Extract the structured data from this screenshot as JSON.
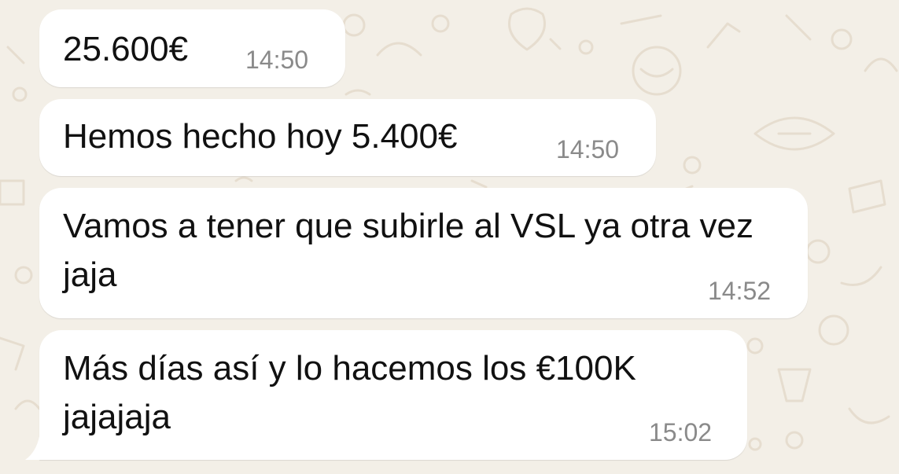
{
  "conversation": {
    "messages": [
      {
        "text": "25.600€",
        "time": "14:50"
      },
      {
        "text": "Hemos hecho hoy 5.400€",
        "time": "14:50"
      },
      {
        "text": "Vamos a tener que subirle al VSL ya otra vez jaja",
        "time": "14:52"
      },
      {
        "text": "Más días así y lo hacemos los €100K jajajaja",
        "time": "15:02"
      }
    ]
  },
  "colors": {
    "wallpaper": "#f3efe7",
    "bubble": "#ffffff",
    "text": "#111111",
    "timestamp": "#8a8a8a"
  }
}
